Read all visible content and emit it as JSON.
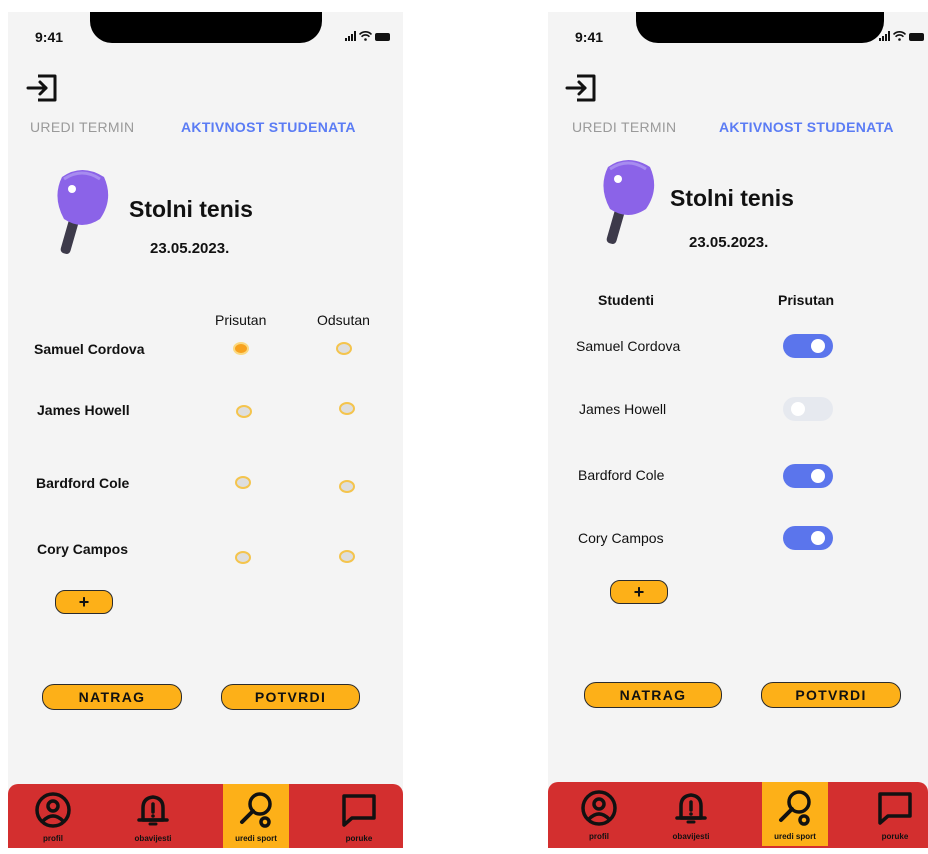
{
  "screens": [
    {
      "status": {
        "time": "9:41"
      },
      "tabs": {
        "edit": "UREDI TERMIN",
        "activity": "AKTIVNOST STUDENATA"
      },
      "sport": {
        "title": "Stolni tenis",
        "date": "23.05.2023."
      },
      "columns": {
        "present": "Prisutan",
        "absent": "Odsutan"
      },
      "students": [
        {
          "name": "Samuel Cordova",
          "attendance": "present"
        },
        {
          "name": "James Howell",
          "attendance": "none"
        },
        {
          "name": "Bardford Cole",
          "attendance": "none"
        },
        {
          "name": "Cory Campos",
          "attendance": "none"
        }
      ],
      "buttons": {
        "add": "+",
        "back": "NATRAG",
        "confirm": "POTVRDI"
      },
      "nav": [
        {
          "label": "profil",
          "icon": "profile-icon"
        },
        {
          "label": "obavijesti",
          "icon": "bell-icon"
        },
        {
          "label": "uredi sport",
          "icon": "racket-icon",
          "active": true
        },
        {
          "label": "poruke",
          "icon": "message-icon"
        }
      ]
    },
    {
      "status": {
        "time": "9:41"
      },
      "tabs": {
        "edit": "UREDI TERMIN",
        "activity": "AKTIVNOST STUDENATA"
      },
      "sport": {
        "title": "Stolni tenis",
        "date": "23.05.2023."
      },
      "columns": {
        "students": "Studenti",
        "present": "Prisutan"
      },
      "students": [
        {
          "name": "Samuel Cordova",
          "present": true
        },
        {
          "name": "James Howell",
          "present": false
        },
        {
          "name": "Bardford Cole",
          "present": true
        },
        {
          "name": "Cory Campos",
          "present": true
        }
      ],
      "buttons": {
        "add": "+",
        "back": "NATRAG",
        "confirm": "POTVRDI"
      },
      "nav": [
        {
          "label": "profil",
          "icon": "profile-icon"
        },
        {
          "label": "obavijesti",
          "icon": "bell-icon"
        },
        {
          "label": "uredi sport",
          "icon": "racket-icon",
          "active": true
        },
        {
          "label": "poruke",
          "icon": "message-icon"
        }
      ]
    }
  ],
  "colors": {
    "accent_blue": "#5b7cf4",
    "button_yellow": "#fdb018",
    "nav_red": "#d32f2f",
    "paddle_purple": "#8b63e8",
    "radio_selected": "#f7a21e"
  }
}
